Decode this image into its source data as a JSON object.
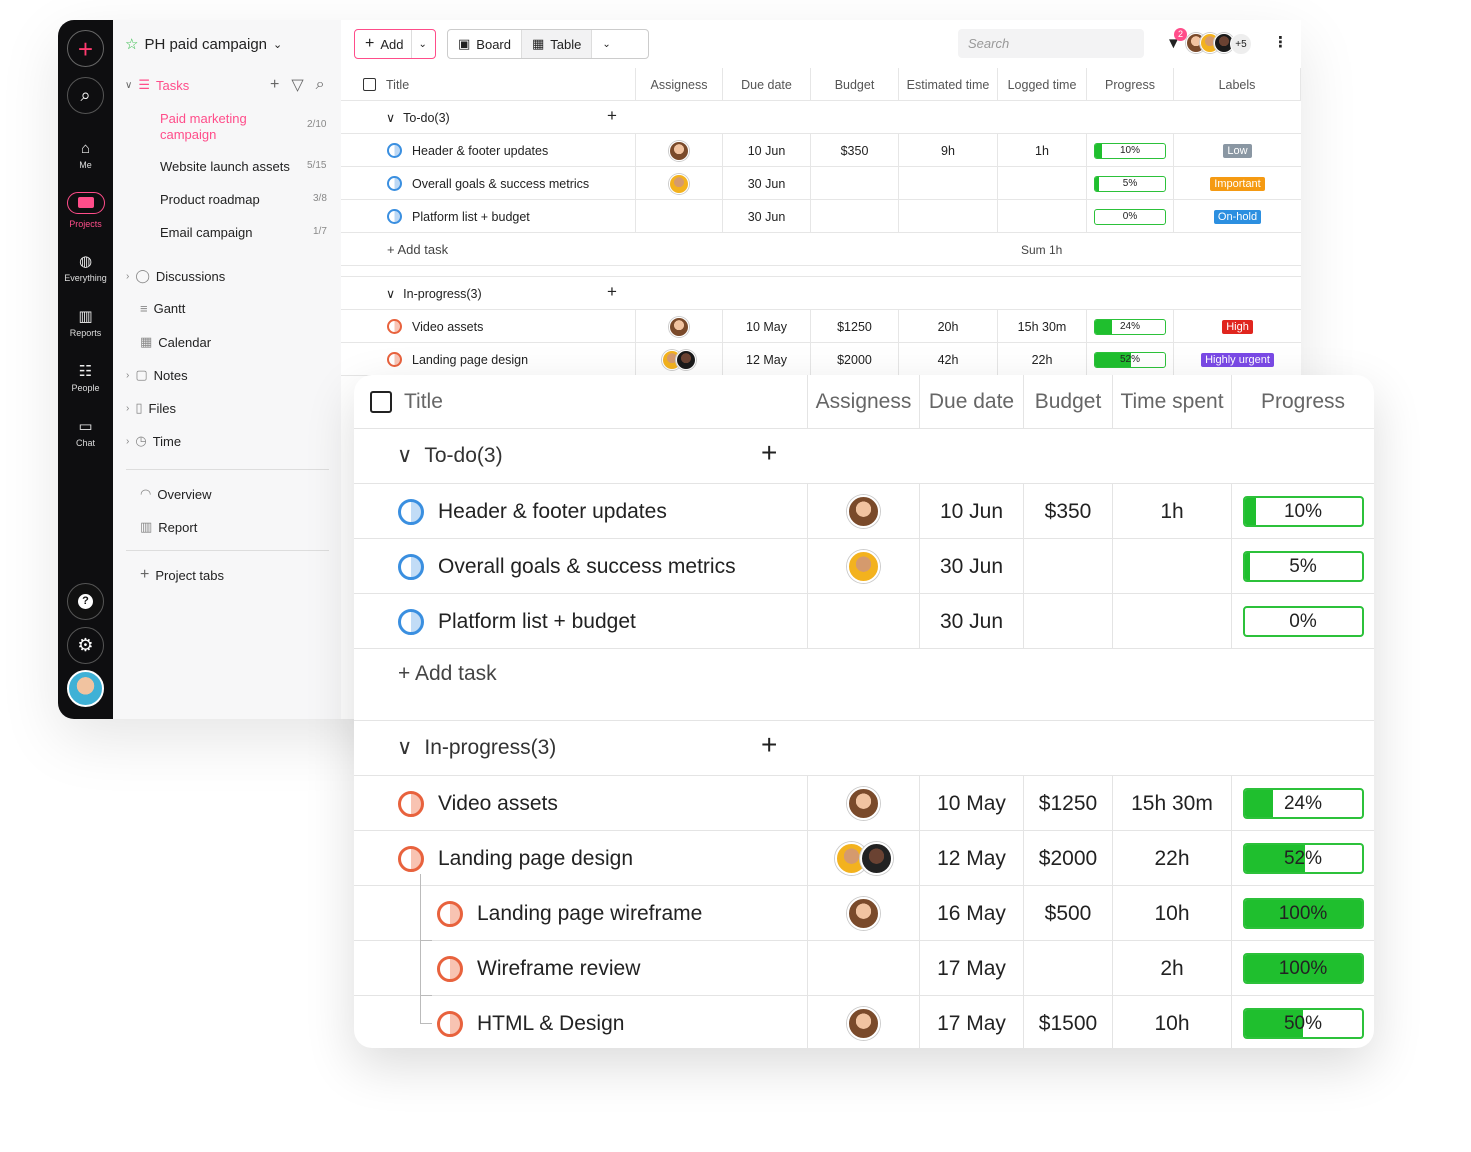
{
  "project": {
    "title": "PH paid campaign"
  },
  "sidebar": {
    "tasks_label": "Tasks",
    "items": [
      {
        "label": "Paid marketing campaign",
        "count": "2/10"
      },
      {
        "label": "Website launch assets",
        "count": "5/15"
      },
      {
        "label": "Product roadmap",
        "count": "3/8"
      },
      {
        "label": "Email campaign",
        "count": "1/7"
      }
    ],
    "sections": [
      "Discussions",
      "Gantt",
      "Calendar",
      "Notes",
      "Files",
      "Time"
    ],
    "overview": "Overview",
    "report": "Report",
    "project_tabs": "Project tabs"
  },
  "rail": {
    "me": "Me",
    "projects": "Projects",
    "everything": "Everything",
    "reports": "Reports",
    "people": "People",
    "chat": "Chat"
  },
  "toolbar": {
    "add": "Add",
    "board": "Board",
    "table": "Table",
    "search_placeholder": "Search",
    "filter_badge": "2",
    "more_users": "+5"
  },
  "small_table": {
    "headers": [
      "Title",
      "Assigness",
      "Due date",
      "Budget",
      "Estimated time",
      "Logged time",
      "Progress",
      "Labels"
    ],
    "groups": [
      {
        "name": "To-do(3)",
        "rows": [
          {
            "title": "Header & footer updates",
            "due": "10 Jun",
            "budget": "$350",
            "est": "9h",
            "logged": "1h",
            "progress": 10,
            "progress_text": "10%",
            "label": "Low",
            "label_color": "#8a97a3"
          },
          {
            "title": "Overall goals & success metrics",
            "due": "30 Jun",
            "budget": "",
            "est": "",
            "logged": "",
            "progress": 5,
            "progress_text": "5%",
            "label": "Important",
            "label_color": "#f59a12"
          },
          {
            "title": "Platform list + budget",
            "due": "30 Jun",
            "budget": "",
            "est": "",
            "logged": "",
            "progress": 0,
            "progress_text": "0%",
            "label": "On-hold",
            "label_color": "#2c8fe0"
          }
        ],
        "add_task": "Add task",
        "sum": "Sum 1h"
      },
      {
        "name": "In-progress(3)",
        "rows": [
          {
            "title": "Video assets",
            "due": "10 May",
            "budget": "$1250",
            "est": "20h",
            "logged": "15h 30m",
            "progress": 24,
            "progress_text": "24%",
            "label": "High",
            "label_color": "#e0251e"
          },
          {
            "title": "Landing page design",
            "due": "12 May",
            "budget": "$2000",
            "est": "42h",
            "logged": "22h",
            "progress": 52,
            "progress_text": "52%",
            "label": "Highly urgent",
            "label_color": "#7a4ae6"
          }
        ]
      }
    ]
  },
  "card_table": {
    "headers": [
      "Title",
      "Assigness",
      "Due date",
      "Budget",
      "Time spent",
      "Progress"
    ],
    "group1": {
      "name": "To-do(3)",
      "rows": [
        {
          "title": "Header & footer updates",
          "due": "10 Jun",
          "budget": "$350",
          "time": "1h",
          "progress": 10,
          "progress_text": "10%"
        },
        {
          "title": "Overall goals & success metrics",
          "due": "30 Jun",
          "budget": "",
          "time": "",
          "progress": 5,
          "progress_text": "5%"
        },
        {
          "title": "Platform list + budget",
          "due": "30 Jun",
          "budget": "",
          "time": "",
          "progress": 0,
          "progress_text": "0%"
        }
      ],
      "add_task": "Add task"
    },
    "group2": {
      "name": "In-progress(3)",
      "rows": [
        {
          "title": "Video assets",
          "due": "10 May",
          "budget": "$1250",
          "time": "15h 30m",
          "progress": 24,
          "progress_text": "24%"
        },
        {
          "title": "Landing page design",
          "due": "12 May",
          "budget": "$2000",
          "time": "22h",
          "progress": 52,
          "progress_text": "52%"
        },
        {
          "title": "Landing page wireframe",
          "due": "16 May",
          "budget": "$500",
          "time": "10h",
          "progress": 100,
          "progress_text": "100%"
        },
        {
          "title": "Wireframe review",
          "due": "17 May",
          "budget": "",
          "time": "2h",
          "progress": 100,
          "progress_text": "100%"
        },
        {
          "title": "HTML & Design",
          "due": "17 May",
          "budget": "$1500",
          "time": "10h",
          "progress": 50,
          "progress_text": "50%"
        }
      ]
    }
  }
}
